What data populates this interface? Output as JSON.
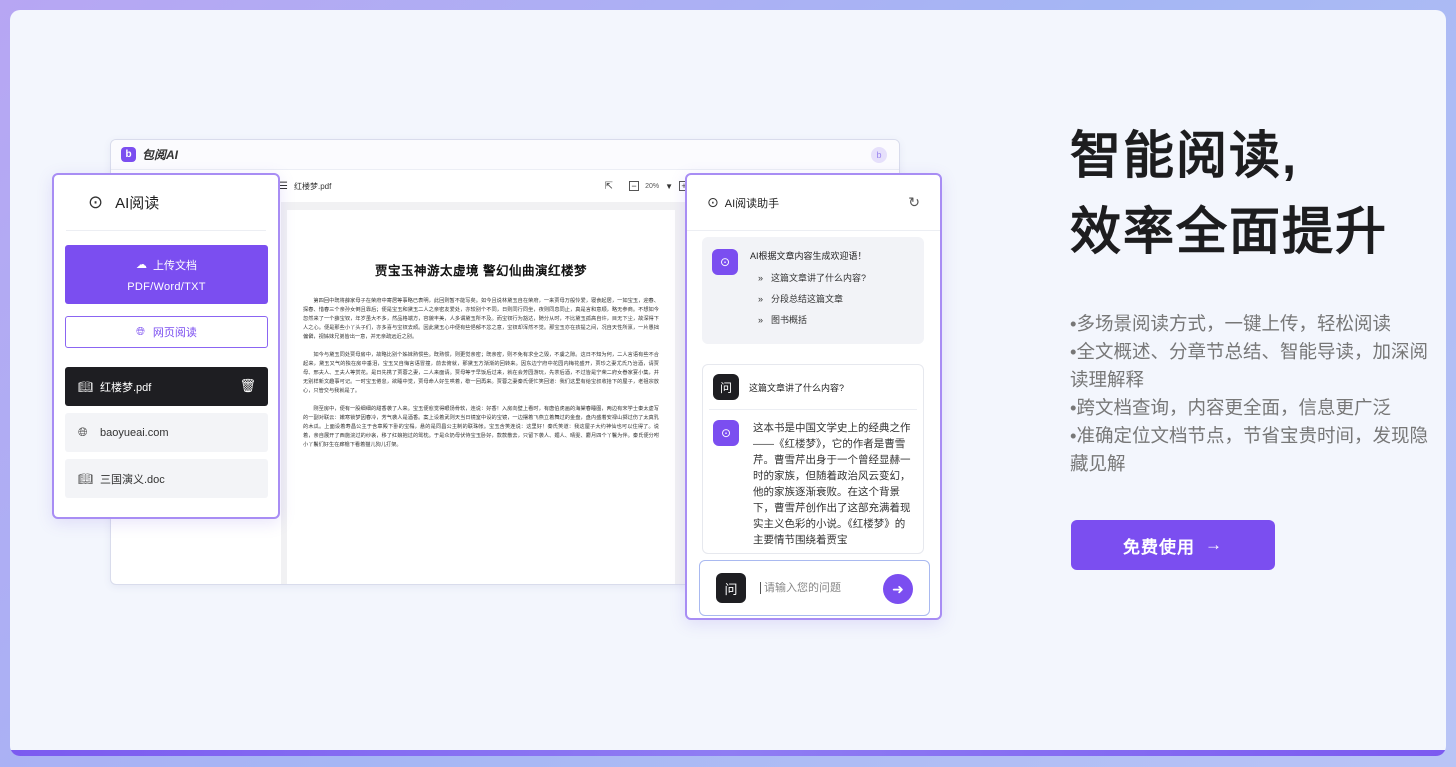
{
  "app": {
    "name": "包阅AI",
    "logo_glyph": "b",
    "avatar_glyph": "b"
  },
  "doc_viewer": {
    "file_name": "红楼梦.pdf",
    "zoom": "20%",
    "title": "贾宝玉神游太虚境 警幻仙曲演红楼梦",
    "paragraphs": [
      "第四回中既将薛家母子在荣府中寄居等事略已表明，此回则暂不能写矣。如今且说林黛玉自在荣府，一来贾母万般怜爱，寝食起居，一如宝玉，迎春、探春、惜春三个亲孙女倒且靠后；便是宝玉和黛玉二人之亲密友爱处，亦较别个不同，日则同行同坐，夜则同息同止，真是言和意顺，略无参商。不想如今忽然来了一个薛宝钗，年岁虽大不多，然品格端方，容貌丰美，人多谓黛玉所不及。而宝钗行为豁达，随分从时，不比黛玉孤高自许，目无下尘，故深得下人之心。便是那些小丫头子们，亦多喜与宝钗去顽。因此黛玉心中便有些悒郁不忿之意，宝钗却浑然不觉。那宝玉亦在孩提之间，况自天性所禀，一片愚拙偏僻，视姊妹兄弟皆出一意，并无亲疏远近之别。",
      "如今与黛玉同处贾母房中，故略比别个姊妹熟惯些。既熟惯，则更觉亲密；既亲密，则不免有求全之毁，不虞之隙。这日不知为何，二人言语有些不合起来，黛玉又气的独在房中垂泪，宝玉又自悔言语冒撞，前去俯就，那黛玉方渐渐的回转来。因东边宁府中花园内梅花盛开，贾珍之妻尤氏乃治酒，请贾母、邢夫人、王夫人等赏花。是日先携了贾蓉之妻，二人来面请。贾母等于早饭后过来，就在会芳园游玩，先茶后酒，不过皆是宁荣二府女眷家宴小集，并无别样新文趣事可记。一时宝玉倦怠，欲睡中觉，贾母命人好生哄着，歇一回再来。贾蓉之妻秦氏便忙笑回道：我们这里有给宝叔收拾下的屋子，老祖宗放心，只管交与我就是了。",
      "刚至房中，便有一股细细的甜香袭了人来。宝玉便愈觉得眼饧骨软，连说：好香！入房向壁上看时，有唐伯虎画的海棠春睡图，两边有宋学士秦太虚写的一副对联云：嫩寒锁梦因春冷，芳气袭人是酒香。案上设着武则天当日镜室中设的宝镜，一边摆着飞燕立着舞过的金盘，盘内盛着安禄山掷过伤了太真乳的木瓜。上面设着寿昌公主于含章殿下卧的宝榻，悬的是同昌公主制的联珠帐。宝玉含笑连说：这里好！秦氏笑道：我这屋子大约神仙也可以住得了。说着，亲自展开了西施浣过的纱衾，移了红娘抱过的鸳枕。于是众奶母伏侍宝玉卧好，款款散去，只留下袭人、媚人、晴雯、麝月四个丫鬟为伴。秦氏便分咐小丫鬟们好生在廊檐下看着猫儿狗儿打架。"
    ]
  },
  "read_panel": {
    "title": "AI阅读",
    "upload_label": "上传文档",
    "upload_formats": "PDF/Word/TXT",
    "web_read_label": "网页阅读",
    "files": [
      {
        "name": "红楼梦.pdf",
        "icon": "book-icon"
      },
      {
        "name": "baoyueai.com",
        "icon": "globe-icon"
      },
      {
        "name": "三国演义.doc",
        "icon": "book-icon"
      }
    ]
  },
  "assistant": {
    "title": "AI阅读助手",
    "welcome": "AI根据文章内容生成欢迎语！",
    "suggestions": [
      "这篇文章讲了什么内容?",
      "分段总结这篇文章",
      "图书概括"
    ],
    "question_glyph": "问",
    "question": "这篇文章讲了什么内容?",
    "answer": "这本书是中国文学史上的经典之作——《红楼梦》，它的作者是曹雪芹。曹雪芹出身于一个曾经显赫一时的家族，但随着政治风云变幻，他的家族逐渐衰败。在这个背景下，曹雪芹创作出了这部充满着现实主义色彩的小说。《红楼梦》的主要情节围绕着贾宝",
    "input_placeholder": "请输入您的问题"
  },
  "hero": {
    "title_line1": "智能阅读,",
    "title_line2": "效率全面提升",
    "features": [
      "•多场景阅读方式，一键上传，轻松阅读",
      "•全文概述、分章节总结、智能导读，加深阅读理解释",
      "•跨文档查询，内容更全面，信息更广泛",
      "•准确定位文档节点，节省宝贵时间，发现隐藏见解"
    ],
    "cta_label": "免费使用"
  },
  "colors": {
    "accent": "#7b4ef0",
    "dark": "#1e1e22",
    "panel_border": "#a88df4"
  }
}
